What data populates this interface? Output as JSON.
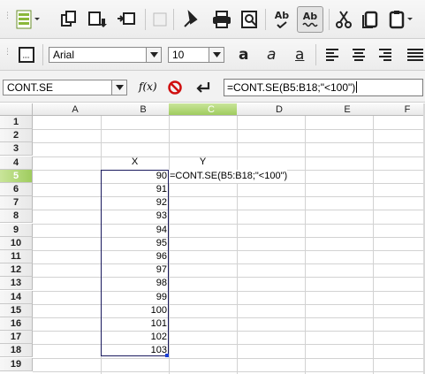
{
  "toolbar": {
    "icons": [
      "toggle-toolbar-icon",
      "paste-icon",
      "clone-icon",
      "insert-icon",
      "form-icon",
      "hyperlink-icon",
      "print-icon",
      "print-preview-icon",
      "spellcheck-icon",
      "autospellcheck-icon",
      "cut-icon",
      "copy-icon",
      "paste-clipboard-icon"
    ],
    "spell_label": "Ab",
    "autospell_label": "Ab"
  },
  "format": {
    "font_name": "Arial",
    "font_size": "10",
    "bold_label": "a",
    "italic_label": "a",
    "underline_label": "a"
  },
  "formula_bar": {
    "name_box": "CONT.SE",
    "fx_label": "f(x)",
    "formula": "=CONT.SE(B5:B18;\"<100\")"
  },
  "sheet": {
    "columns": [
      "A",
      "B",
      "C",
      "D",
      "E",
      "F"
    ],
    "active_column": "C",
    "rows": [
      "1",
      "2",
      "3",
      "4",
      "5",
      "6",
      "7",
      "8",
      "9",
      "10",
      "11",
      "12",
      "13",
      "14",
      "15",
      "16",
      "17",
      "18",
      "19"
    ],
    "active_row": "5",
    "header_x": "X",
    "header_y": "Y",
    "x_values": [
      "90",
      "91",
      "92",
      "93",
      "94",
      "95",
      "96",
      "97",
      "98",
      "99",
      "100",
      "101",
      "102",
      "103"
    ],
    "editing_cell_text": "=CONT.SE(B5:B18;\"<100\")"
  }
}
